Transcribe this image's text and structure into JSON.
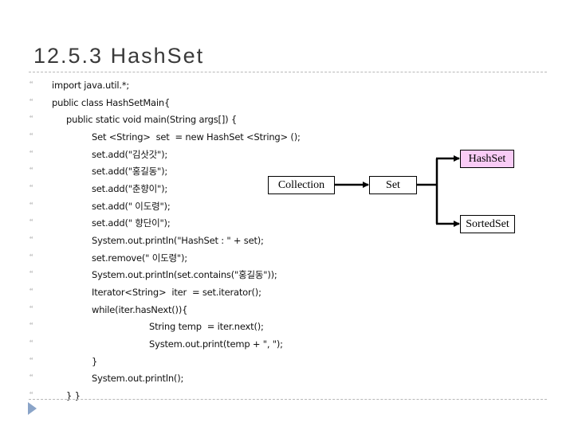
{
  "title": "12.5.3 HashSet",
  "bullet_glyph": "“",
  "colors": {
    "hashset_fill": "#f9ccf6",
    "nav_triangle": "#8aa4c8",
    "rule": "#b8b8b8"
  },
  "code_lines": [
    {
      "level": 0,
      "text": "import java.util.*;"
    },
    {
      "level": 0,
      "text": "public class HashSetMain{"
    },
    {
      "level": 1,
      "text": "public static void main(String args[]) {"
    },
    {
      "level": 2,
      "text": "Set <String>  set  = new HashSet <String> ();"
    },
    {
      "level": 2,
      "text": "set.add(\"김삿갓\");"
    },
    {
      "level": 2,
      "text": "set.add(\"홍길동\");"
    },
    {
      "level": 2,
      "text": "set.add(\"춘향이\");"
    },
    {
      "level": 2,
      "text": "set.add(\" 이도령\");"
    },
    {
      "level": 2,
      "text": "set.add(\" 향단이\");"
    },
    {
      "level": 2,
      "text": "System.out.println(\"HashSet : \" + set);"
    },
    {
      "level": 2,
      "text": "set.remove(\" 이도령\");"
    },
    {
      "level": 2,
      "text": "System.out.println(set.contains(\"홍길동\"));"
    },
    {
      "level": 2,
      "text": "Iterator<String>  iter  = set.iterator();"
    },
    {
      "level": 2,
      "text": "while(iter.hasNext()){"
    },
    {
      "level": 3,
      "text": "String temp  = iter.next();"
    },
    {
      "level": 3,
      "text": "System.out.print(temp + \", \");"
    },
    {
      "level": 2,
      "text": "}"
    },
    {
      "level": 2,
      "text": "System.out.println();"
    },
    {
      "level": 1,
      "text": "} }"
    }
  ],
  "diagram": {
    "nodes": {
      "collection": "Collection",
      "set": "Set",
      "hashset": "HashSet",
      "sortedset": "SortedSet"
    },
    "edges": [
      {
        "from": "collection",
        "to": "set"
      },
      {
        "from": "set",
        "to": "hashset"
      },
      {
        "from": "set",
        "to": "sortedset"
      }
    ],
    "highlighted": "hashset"
  }
}
